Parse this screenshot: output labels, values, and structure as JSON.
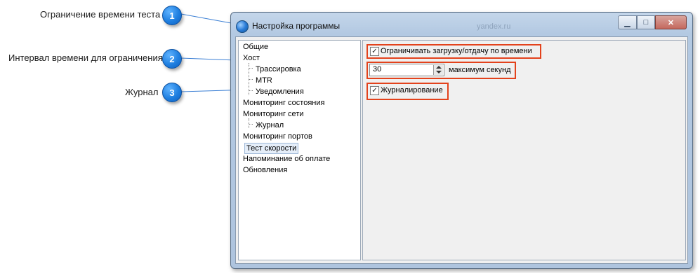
{
  "callouts": [
    {
      "number": "1",
      "label": "Ограничение времени теста"
    },
    {
      "number": "2",
      "label": "Интервал времени для ограничения"
    },
    {
      "number": "3",
      "label": "Журнал"
    }
  ],
  "window": {
    "title": "Настройка программы",
    "ghost_text": "yandex.ru"
  },
  "tree": {
    "items": [
      {
        "label": "Общие"
      },
      {
        "label": "Хост"
      },
      {
        "label": "Трассировка"
      },
      {
        "label": "MTR"
      },
      {
        "label": "Уведомления"
      },
      {
        "label": "Мониторинг состояния"
      },
      {
        "label": "Мониторинг сети"
      },
      {
        "label": "Журнал"
      },
      {
        "label": "Мониторинг портов"
      },
      {
        "label": "Тест скорости",
        "selected": true
      },
      {
        "label": "Напоминание об оплате"
      },
      {
        "label": "Обновления"
      }
    ]
  },
  "settings": {
    "limit_checkbox_label": "Ограничивать загрузку/отдачу по времени",
    "limit_checked": true,
    "interval_value": "30",
    "interval_unit_label": "максимум секунд",
    "logging_checkbox_label": "Журналирование",
    "logging_checked": true
  },
  "colors": {
    "highlight": "#e3421c",
    "badge": "#1f7fe0"
  },
  "icons": {
    "minimize": "minimize-icon",
    "maximize": "maximize-icon",
    "close": "close-icon",
    "app": "globe-icon"
  }
}
